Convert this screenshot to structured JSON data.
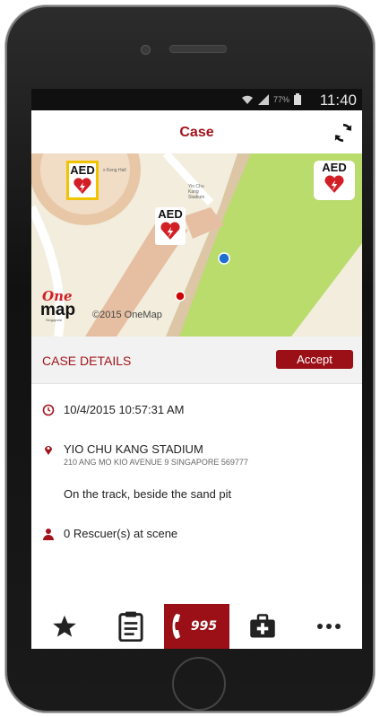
{
  "status_bar": {
    "battery": "77%",
    "time": "11:40"
  },
  "header": {
    "title": "Case",
    "refresh_icon": "refresh-icon"
  },
  "map": {
    "marker_aed_label_1": "AED",
    "marker_aed_label_2": "AED",
    "marker_aed_label_3": "AED",
    "small_text_1": "x Keng Hall",
    "small_text_2": "Yio Chu Kang Stadium",
    "logo_one": "One",
    "logo_map": "map",
    "logo_sub": "Singapore",
    "copyright": "©2015 OneMap",
    "colors": {
      "grass": "#b9dc6d",
      "land": "#f2eddc",
      "track": "#e8c7a7",
      "road": "#ffffff"
    }
  },
  "case_details": {
    "section_label": "CASE DETAILS",
    "accept_label": "Accept",
    "datetime": "10/4/2015 10:57:31 AM",
    "location_name": "YIO CHU KANG STADIUM",
    "location_address": "210 ANG MO KIO AVENUE 9 SINGAPORE 569777",
    "description": "On the track, beside the sand pit",
    "rescuers": "0 Rescuer(s) at scene"
  },
  "tab_bar": {
    "tabs": [
      {
        "icon": "star-icon"
      },
      {
        "icon": "clipboard-icon"
      },
      {
        "icon": "phone-995-icon",
        "label": "995"
      },
      {
        "icon": "medical-kit-icon"
      },
      {
        "icon": "more-icon"
      }
    ]
  },
  "accent_color": "#9b1016"
}
